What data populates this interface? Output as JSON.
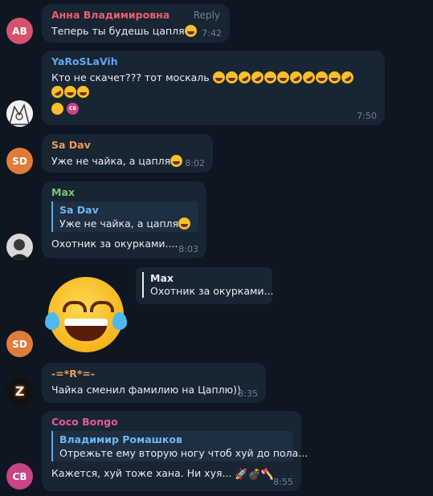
{
  "colors": {
    "background": "#0e1621",
    "bubble": "#182533",
    "quote_accent": "#70b7f0"
  },
  "messages": [
    {
      "avatar_initials": "AB",
      "avatar_color": "#d4536a",
      "sender": "Анна Владимировна",
      "sender_color": "#e8606e",
      "reply_label": "Reply",
      "text": "Теперь ты будешь цапля",
      "emojis": [
        "joy"
      ],
      "time": "7:42"
    },
    {
      "avatar_kind": "picture",
      "sender": "YaRoSLaVih",
      "sender_color": "#62a9ef",
      "text_line1": "Кто не скачет??? тот москаль",
      "emojis_line1": [
        "joy",
        "joy",
        "rofl",
        "rofl",
        "joy",
        "joy",
        "rofl",
        "rofl",
        "joy",
        "joy",
        "rofl"
      ],
      "emojis_line2": [
        "rofl",
        "joy",
        "joy"
      ],
      "reactions": [
        {
          "type": "emoji",
          "name": "grin"
        },
        {
          "type": "avatar",
          "initials": "СВ",
          "color": "#c94482"
        }
      ],
      "time": "7:50"
    },
    {
      "avatar_initials": "SD",
      "avatar_color": "#e07c39",
      "sender": "Sa Dav",
      "sender_color": "#ef9c56",
      "text": "Уже не чайка, а цапля",
      "emojis": [
        "joy"
      ],
      "time": "8:02"
    },
    {
      "avatar_kind": "picture",
      "sender": "Max",
      "sender_color": "#7cc86b",
      "quote_name": "Sa Dav",
      "quote_text": "Уже не чайка, а цапля",
      "text": "Охотник за окурками....",
      "time": "8:03"
    },
    {
      "avatar_initials": "SD",
      "avatar_color": "#e07c39",
      "sticker": "face-with-tears-of-joy",
      "reply_name": "Max",
      "reply_text": "Охотник за окурками..."
    },
    {
      "avatar_kind": "logo",
      "avatar_letter": "Z",
      "sender": "-=*R*=-",
      "sender_color": "#ef9c56",
      "text": "Чайка сменил фамилию на Цаплю))",
      "time": "8:35"
    },
    {
      "avatar_initials": "СВ",
      "avatar_color": "#c94482",
      "sender": "Coco Bongo",
      "sender_color": "#e45b9a",
      "quote_name": "Владимир Ромашков",
      "quote_text": "Отрежьте ему вторую ногу чтоб хуй до пола...",
      "text": "Кажется, хуй тоже хана. Ни хуя...",
      "trailing_icons": [
        "rocket-icon",
        "bomb-icon",
        "axe-icon"
      ],
      "time": "8:55"
    }
  ]
}
